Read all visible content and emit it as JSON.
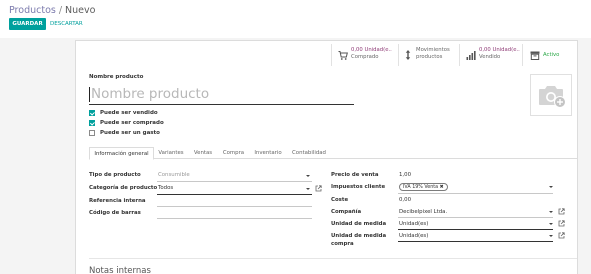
{
  "breadcrumb": {
    "parent": "Productos",
    "separator": "/",
    "current": "Nuevo"
  },
  "actions": {
    "save": "GUARDAR",
    "discard": "DESCARTAR"
  },
  "stat_buttons": [
    {
      "value": "0,00 Unidad(e..",
      "label": "Comprado",
      "icon": "cart-icon"
    },
    {
      "value": "Movimientos",
      "label": "productos",
      "icon": "arrows-updown-icon"
    },
    {
      "value": "0,00 Unidad(e..",
      "label": "Vendido",
      "icon": "bar-chart-icon"
    },
    {
      "value": "",
      "label": "Activo",
      "icon": "archive-icon"
    }
  ],
  "form": {
    "name_label": "Nombre producto",
    "name_placeholder": "Nombre producto",
    "checkboxes": [
      {
        "label": "Puede ser vendido",
        "checked": true
      },
      {
        "label": "Puede ser comprado",
        "checked": true
      },
      {
        "label": "Puede ser un gasto",
        "checked": false
      }
    ]
  },
  "tabs": [
    "Información general",
    "Variantes",
    "Ventas",
    "Compra",
    "Inventario",
    "Contabilidad"
  ],
  "left_fields": [
    {
      "label": "Tipo de producto",
      "value": "Consumible"
    },
    {
      "label": "Categoría de producto",
      "value": "Todos"
    },
    {
      "label": "Referencia interna",
      "value": ""
    },
    {
      "label": "Código de barras",
      "value": ""
    }
  ],
  "right_fields": {
    "precio_label": "Precio de venta",
    "precio_value": "1,00",
    "impuestos_label": "Impuestos cliente",
    "impuestos_tag": "IVA 19% Venta",
    "coste_label": "Coste",
    "coste_value": "0,00",
    "compania_label": "Compañía",
    "compania_value": "Decibelpixel Ltda.",
    "um_label": "Unidad de medida",
    "um_value": "Unidad(es)",
    "umc_label_1": "Unidad de medida",
    "umc_label_2": "compra",
    "umc_value": "Unidad(es)"
  },
  "notes_title": "Notas internas",
  "colors": {
    "primary": "#00a09d",
    "accent": "#7c7bad",
    "stat_value": "#8f3b76",
    "active": "#28a745"
  }
}
